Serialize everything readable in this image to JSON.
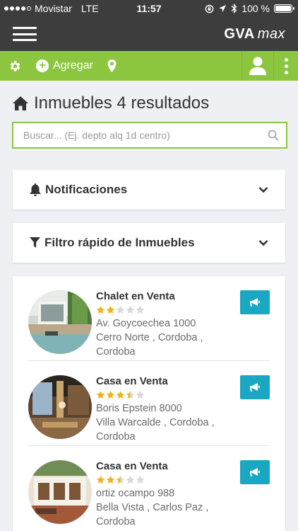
{
  "status_bar": {
    "carrier": "Movistar",
    "network": "LTE",
    "time": "11:57",
    "battery": "100 %"
  },
  "header": {
    "logo_main": "GVA",
    "logo_sub": "max"
  },
  "toolbar": {
    "add_label": "Agregar"
  },
  "page": {
    "title": "Inmuebles 4 resultados"
  },
  "search": {
    "placeholder": "Buscar... (Ej. depto alq 1d centro)"
  },
  "sections": {
    "notifications": "Notificaciones",
    "quick_filter": "Filtro rápido de Inmuebles"
  },
  "results": [
    {
      "title": "Chalet en Venta",
      "rating": 2,
      "address": "Av. Goycoechea 1000",
      "location": "Cerro Norte , Cordoba ,",
      "city": "Cordoba"
    },
    {
      "title": "Casa en Venta",
      "rating": 3.5,
      "address": "Boris Epstein 8000",
      "location": "Villa Warcalde , Cordoba ,",
      "city": "Cordoba"
    },
    {
      "title": "Casa en Venta",
      "rating": 2.5,
      "address": "ortiz ocampo 988",
      "location": "Bella Vista , Carlos Paz ,",
      "city": "Cordoba"
    }
  ],
  "colors": {
    "header": "#3d3d3d",
    "accent_green": "#8cc63f",
    "promo_blue": "#1aa7c2",
    "star_filled": "#f2b01e",
    "star_empty": "#d8d8d8"
  },
  "icons": {
    "settings": "gear-icon",
    "add": "plus-circle-icon",
    "location": "map-marker-icon",
    "user": "user-icon",
    "more": "more-vertical-icon",
    "home": "home-icon",
    "search": "search-icon",
    "notifications": "bell-icon",
    "filter": "filter-icon",
    "expand": "chevron-down-icon",
    "promote": "megaphone-icon"
  }
}
